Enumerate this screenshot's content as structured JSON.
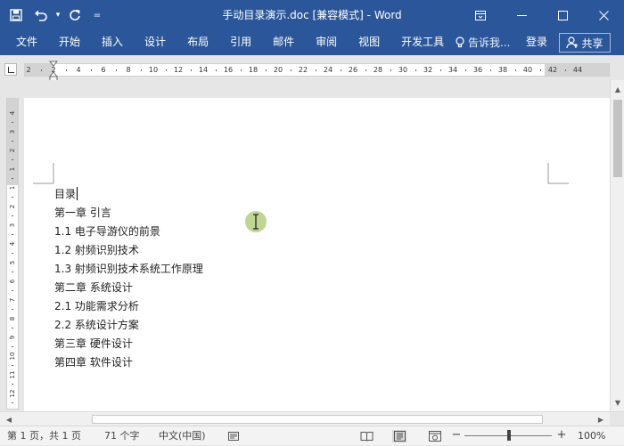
{
  "window": {
    "title": "手动目录演示.doc [兼容模式] - Word",
    "colors": {
      "titlebar": "#2b579a",
      "page": "#ffffff",
      "workspace": "#e6e6e6"
    }
  },
  "quick_access": {
    "icons": [
      "save-icon",
      "undo-icon",
      "redo-icon",
      "customize-qat-icon"
    ],
    "undo_dropdown": "▾",
    "customize": "="
  },
  "window_controls": {
    "icons": [
      "ribbon-display-icon",
      "minimize-icon",
      "maximize-icon",
      "close-icon"
    ]
  },
  "ribbon": {
    "tabs": [
      {
        "label": "文件"
      },
      {
        "label": "开始"
      },
      {
        "label": "插入"
      },
      {
        "label": "设计"
      },
      {
        "label": "布局"
      },
      {
        "label": "引用"
      },
      {
        "label": "邮件"
      },
      {
        "label": "审阅"
      },
      {
        "label": "视图"
      },
      {
        "label": "开发工具"
      }
    ],
    "tell_me": "告诉我...",
    "login": "登录",
    "share": "共享"
  },
  "ruler": {
    "ticks": [
      "2",
      "2",
      "4",
      "6",
      "8",
      "10",
      "12",
      "14",
      "16",
      "18",
      "20",
      "22",
      "24",
      "26",
      "28",
      "30",
      "32",
      "34",
      "36",
      "38",
      "40",
      "42",
      "44"
    ],
    "vertical_ticks": [
      "4",
      "3",
      "2",
      "1",
      "1",
      "2",
      "3",
      "4",
      "5",
      "6",
      "7",
      "8",
      "9",
      "10",
      "11",
      "12"
    ]
  },
  "document": {
    "lines": [
      "目录",
      "第一章  引言",
      "1.1  电子导游仪的前景",
      "1.2  射频识别技术",
      "1.3  射频识别技术系统工作原理",
      "第二章  系统设计",
      "2.1  功能需求分析",
      "2.2  系统设计方案",
      "第三章  硬件设计",
      "第四章  软件设计"
    ]
  },
  "status": {
    "page": "第 1 页，共 1 页",
    "words": "71 个字",
    "language": "中文(中国)",
    "zoom": "100%",
    "zoom_minus": "−",
    "zoom_plus": "+",
    "view_icons": [
      "read-mode-icon",
      "print-layout-icon",
      "web-layout-icon"
    ]
  }
}
